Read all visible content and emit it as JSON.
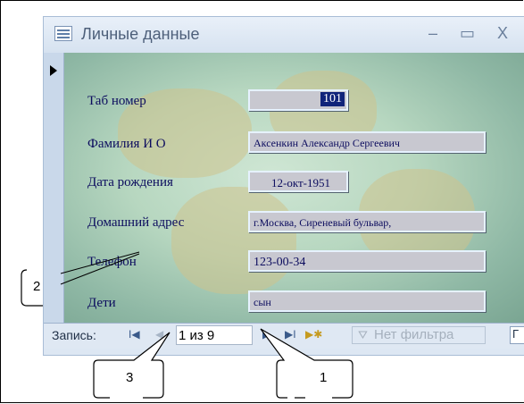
{
  "window": {
    "title": "Личные данные",
    "minimize": "–",
    "maximize": "▭",
    "close": "X"
  },
  "form": {
    "tab_label": "Таб номер",
    "tab_value": "101",
    "name_label": "Фамилия И О",
    "name_value": "Аксенкин Александр Сергеевич",
    "birth_label": "Дата рождения",
    "birth_value": "12-окт-1951",
    "address_label": "Домашний адрес",
    "address_value": "г.Москва, Сиреневый бульвар,",
    "phone_label": "Телефон",
    "phone_value": "123-00-34",
    "children_label": "Дети",
    "children_value": "сын"
  },
  "navigation": {
    "record_label": "Запись:",
    "first": "I◀",
    "prev": "◀",
    "counter": "1 из 9",
    "next": "▶",
    "last": "▶I",
    "new": "▶✱",
    "filter_label": "Нет фильтра",
    "search_stub": "Г"
  },
  "callouts": {
    "c1": "1",
    "c2": "2",
    "c3": "3"
  },
  "colors": {
    "label_text": "#0c0c5e",
    "field_bg": "#c8c8d0",
    "selected_value_bg": "#10247a"
  }
}
